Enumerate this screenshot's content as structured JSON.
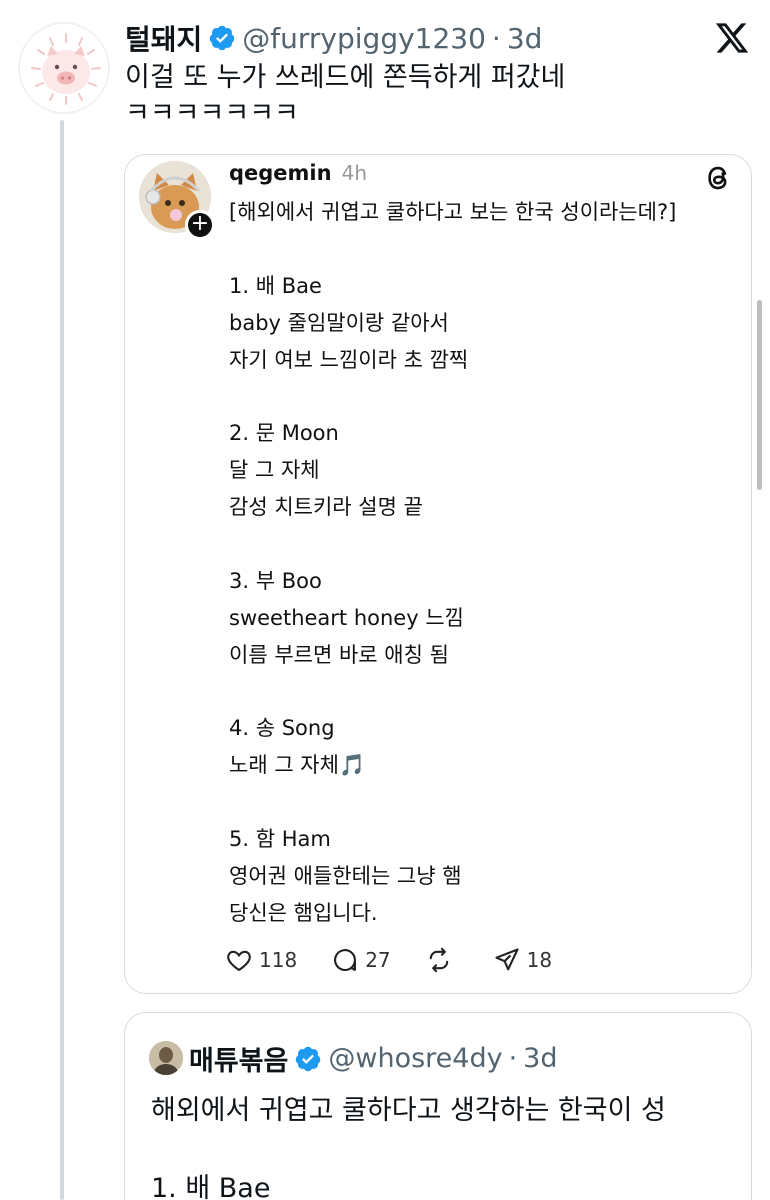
{
  "tweet": {
    "author_name": "털돼지",
    "handle": "@furrypiggy1230",
    "separator": "·",
    "time": "3d",
    "text": "이걸 또 누가 쓰레드에 쫀득하게 퍼갔네 ㅋㅋㅋㅋㅋㅋㅋ",
    "avatar_icon": "pig-avatar",
    "platform_icon": "x-logo-icon"
  },
  "threads_post": {
    "username": "qegemin",
    "time": "4h",
    "avatar_icon": "cat-avatar",
    "follow_icon": "plus-icon",
    "platform_icon": "threads-logo-icon",
    "lines": [
      "[해외에서 귀엽고 쿨하다고 보는 한국 성이라는데?]",
      "",
      "1. 배 Bae",
      "baby 줄임말이랑 같아서",
      "자기 여보 느낌이라 초 깜찍",
      "",
      "2. 문 Moon",
      "달 그 자체",
      "감성 치트키라 설명 끝",
      "",
      "3. 부 Boo",
      "sweetheart honey 느낌",
      "이름 부르면 바로 애칭 됨",
      "",
      "4. 송 Song",
      "노래 그 자체🎵",
      "",
      "5. 함 Ham",
      "영어권 애들한테는 그냥 햄",
      "당신은 햄입니다."
    ],
    "actions": {
      "likes": "118",
      "replies": "27",
      "reposts": "",
      "shares": "18"
    }
  },
  "quoted_tweet": {
    "author_name": "매튜볶음",
    "handle": "@whosre4dy",
    "separator": "·",
    "time": "3d",
    "text_line1": "해외에서 귀엽고 쿨하다고 생각하는 한국이 성",
    "text_line2": "1. 배 Bae",
    "avatar_icon": "user-avatar"
  },
  "colors": {
    "verified": "#1d9bf0",
    "muted": "#536471",
    "border": "#d6dde2",
    "thread_line": "#cfd9de"
  }
}
